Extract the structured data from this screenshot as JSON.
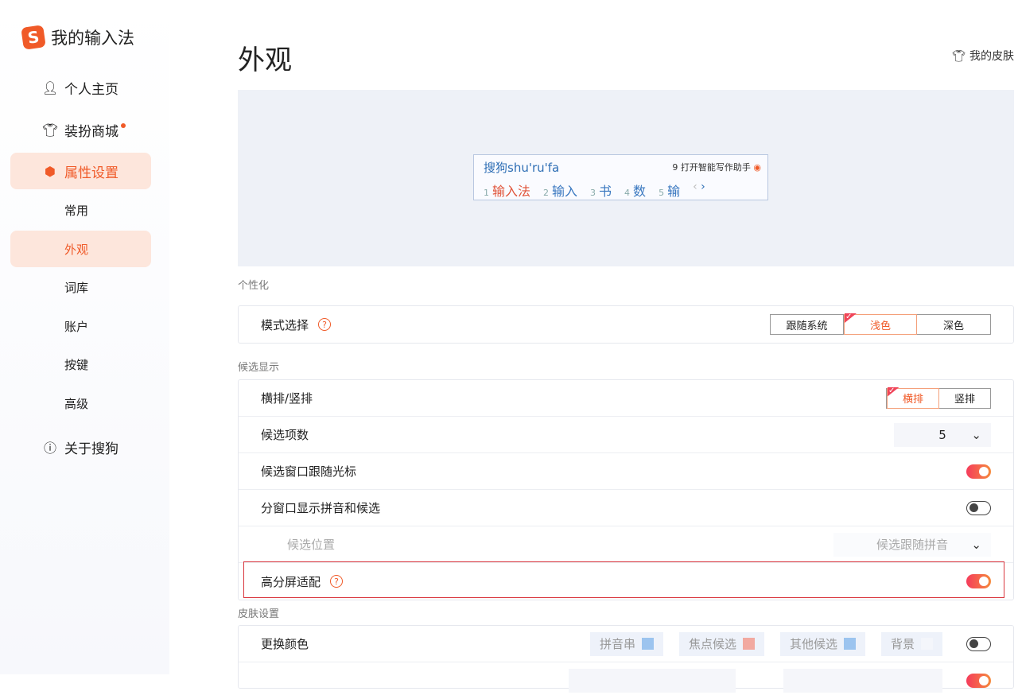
{
  "sidebar": {
    "app_title": "我的输入法",
    "items": [
      {
        "label": "个人主页"
      },
      {
        "label": "装扮商城"
      },
      {
        "label": "属性设置"
      }
    ],
    "sub_items": [
      "常用",
      "外观",
      "词库",
      "账户",
      "按键",
      "高级"
    ],
    "about": "关于搜狗"
  },
  "header": {
    "title": "外观",
    "my_skin": "我的皮肤"
  },
  "preview": {
    "pinyin_prefix": "搜狗",
    "pinyin": "shu'ru'fa",
    "hint": "9 打开智能写作助手",
    "candidates": [
      {
        "n": "1",
        "t": "输入法"
      },
      {
        "n": "2",
        "t": "输入"
      },
      {
        "n": "3",
        "t": "书"
      },
      {
        "n": "4",
        "t": "数"
      },
      {
        "n": "5",
        "t": "输"
      }
    ]
  },
  "personalize": {
    "section": "个性化",
    "mode_label": "模式选择",
    "mode_options": [
      "跟随系统",
      "浅色",
      "深色"
    ],
    "selected": "浅色"
  },
  "candidate_display": {
    "section": "候选显示",
    "orientation_label": "横排/竖排",
    "orientation_options": [
      "横排",
      "竖排"
    ],
    "selected": "横排",
    "count_label": "候选项数",
    "count_value": "5",
    "follow_cursor_label": "候选窗口跟随光标",
    "follow_cursor": true,
    "split_window_label": "分窗口显示拼音和候选",
    "split_window": false,
    "position_label": "候选位置",
    "position_value": "候选跟随拼音",
    "hidpi_label": "高分屏适配",
    "hidpi": true
  },
  "skin": {
    "section": "皮肤设置",
    "color_label": "更换颜色",
    "chips": [
      {
        "label": "拼音串",
        "color": "#9cc4ef"
      },
      {
        "label": "焦点候选",
        "color": "#f2a9a0"
      },
      {
        "label": "其他候选",
        "color": "#9cc4ef"
      },
      {
        "label": "背景",
        "color": "#f4f6fb"
      }
    ],
    "color_toggle": false
  },
  "colors": {
    "accent": "#f05a28"
  }
}
